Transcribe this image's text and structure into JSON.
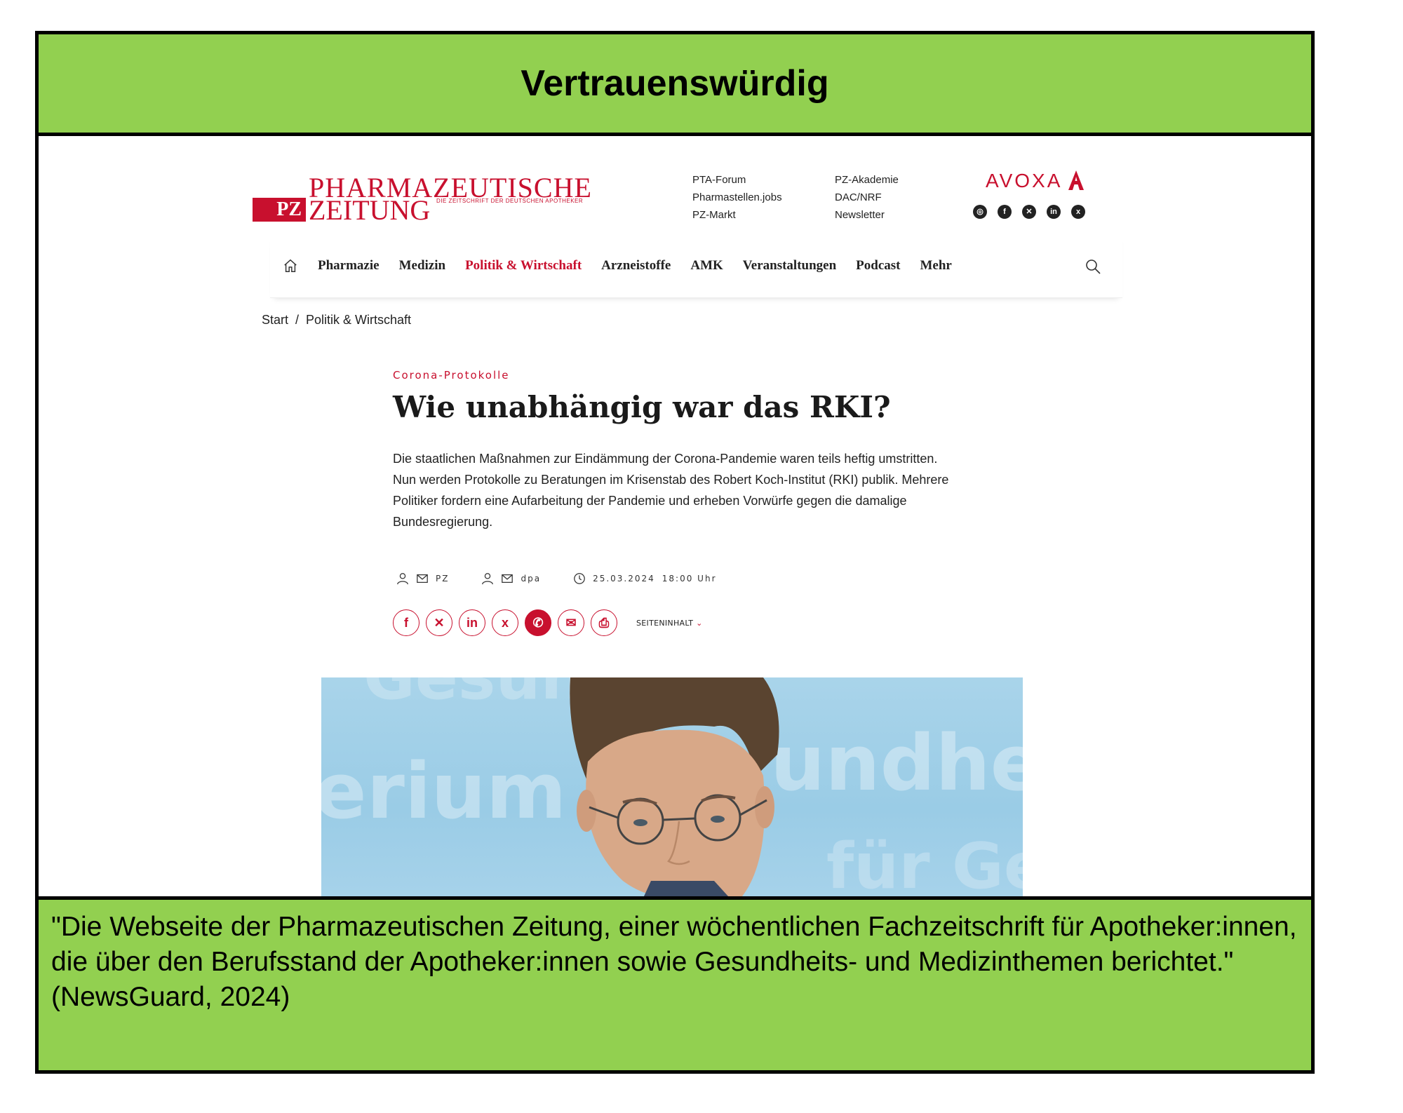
{
  "banner": {
    "title": "Vertrauenswürdig",
    "quote": "\"Die Webseite der Pharmazeutischen Zeitung, einer wöchentlichen Fachzeitschrift für Apotheker:innen, die über den Berufsstand der Apotheker:innen sowie Gesundheits- und Medizinthemen berichtet.\" (NewsGuard, 2024)"
  },
  "site": {
    "logo_line1": "PHARMAZEUTISCHE",
    "logo_badge": "PZ",
    "logo_line2": "ZEITUNG",
    "logo_tagline": "DIE ZEITSCHRIFT DER DEUTSCHEN APOTHEKER",
    "links_col1": [
      "PTA-Forum",
      "Pharmastellen.jobs",
      "PZ-Markt"
    ],
    "links_col2": [
      "PZ-Akademie",
      "DAC/NRF",
      "Newsletter"
    ],
    "publisher": "AVOXA",
    "social": [
      "instagram-icon",
      "facebook-icon",
      "x-icon",
      "linkedin-icon",
      "xing-icon"
    ],
    "accent_color": "#c8102e"
  },
  "nav": {
    "items": [
      "Pharmazie",
      "Medizin",
      "Politik & Wirtschaft",
      "Arzneistoffe",
      "AMK",
      "Veranstaltungen",
      "Podcast",
      "Mehr"
    ],
    "active": "Politik & Wirtschaft"
  },
  "breadcrumb": [
    "Start",
    "Politik & Wirtschaft"
  ],
  "article": {
    "kicker": "Corona-Protokolle",
    "headline": "Wie unabhängig war das RKI?",
    "lead": "Die staatlichen Maßnahmen zur Eindämmung der Corona-Pandemie waren teils heftig umstritten. Nun werden Protokolle zu Beratungen im Krisenstab des Robert Koch-Institut (RKI) publik. Mehrere Politiker fordern eine Aufarbeitung der Pandemie und erheben Vorwürfe gegen die damalige Bundesregierung.",
    "author1": "PZ",
    "author2": "dpa",
    "date": "25.03.2024",
    "time": "18:00 Uhr",
    "share_label": "SEITENINHALT"
  }
}
